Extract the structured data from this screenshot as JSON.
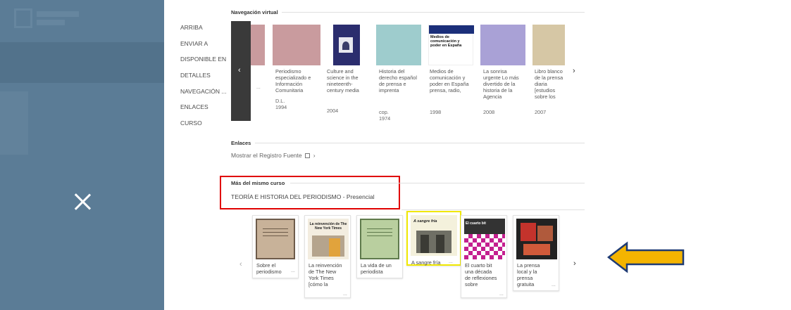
{
  "nav": [
    "ARRIBA",
    "ENVIAR A",
    "DISPONIBLE EN",
    "DETALLES",
    "NAVEGACIÓN ...",
    "ENLACES",
    "CURSO"
  ],
  "virtual_nav": {
    "title": "Navegación virtual",
    "books": [
      {
        "title": "Periodismo especializado e Información Comunitaria",
        "year": "D.L. 1994",
        "color": "#c99b9e"
      },
      {
        "title": "Culture and science in the nineteenth-century media",
        "year": "2004",
        "color": "#ffffff"
      },
      {
        "title": "Historia del derecho español de prensa e imprenta",
        "year": "cop. 1974",
        "color": "#9ecccd"
      },
      {
        "title": "Medios de comunicación y poder en España prensa, radio,",
        "year": "1998",
        "color": "#ffffff"
      },
      {
        "title": "La sonrisa urgente Lo más divertido de la historia de la Agencia",
        "year": "2008",
        "color": "#a9a1d6"
      },
      {
        "title": "Libro blanco de la prensa diaria [estudios sobre los",
        "year": "2007",
        "color": "#d6c7a5"
      }
    ],
    "partial_color": "#c99b9e",
    "cover_text": "Medios de comunicación y poder en España"
  },
  "links": {
    "title": "Enlaces",
    "source_link": "Mostrar el Registro Fuente"
  },
  "course": {
    "title": "Más del mismo curso",
    "name": "TEORÍA E HISTORIA DEL PERIODISMO - Presencial",
    "books": [
      {
        "title": "Sobre el periodismo"
      },
      {
        "title": "La reinvención de The New York Times [cómo la"
      },
      {
        "title": "La vida de un periodista"
      },
      {
        "title": "A sangre fría"
      },
      {
        "title": "El cuarto bit una década de reflexiones sobre"
      },
      {
        "title": "La prensa local y la prensa gratuita"
      }
    ],
    "cover_texts": [
      "La reinvención de The New York Times",
      "A sangre fría",
      "El cuarto bit"
    ]
  },
  "colors": {
    "overlay": "#5b7c96",
    "highlight_red": "#e00000",
    "highlight_yellow": "#f0e800",
    "arrow_fill": "#f4b400",
    "arrow_stroke": "#1f3b73"
  }
}
